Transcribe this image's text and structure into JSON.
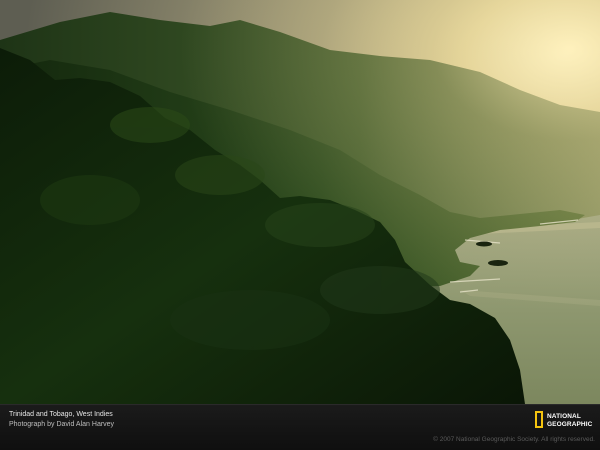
{
  "caption": {
    "title": "Trinidad and Tobago, West Indies",
    "credit": "Photograph by David Alan Harvey"
  },
  "brand": {
    "line1": "NATIONAL",
    "line2": "GEOGRAPHIC",
    "frame_color": "#f5c40f"
  },
  "copyright": "© 2007 National Geographic Society. All rights reserved.",
  "colors": {
    "sky_glow": "#fff3c2",
    "sea": "#8f9a6e",
    "forest_dark": "#0d1f0a",
    "caption_bar": "#141414"
  }
}
